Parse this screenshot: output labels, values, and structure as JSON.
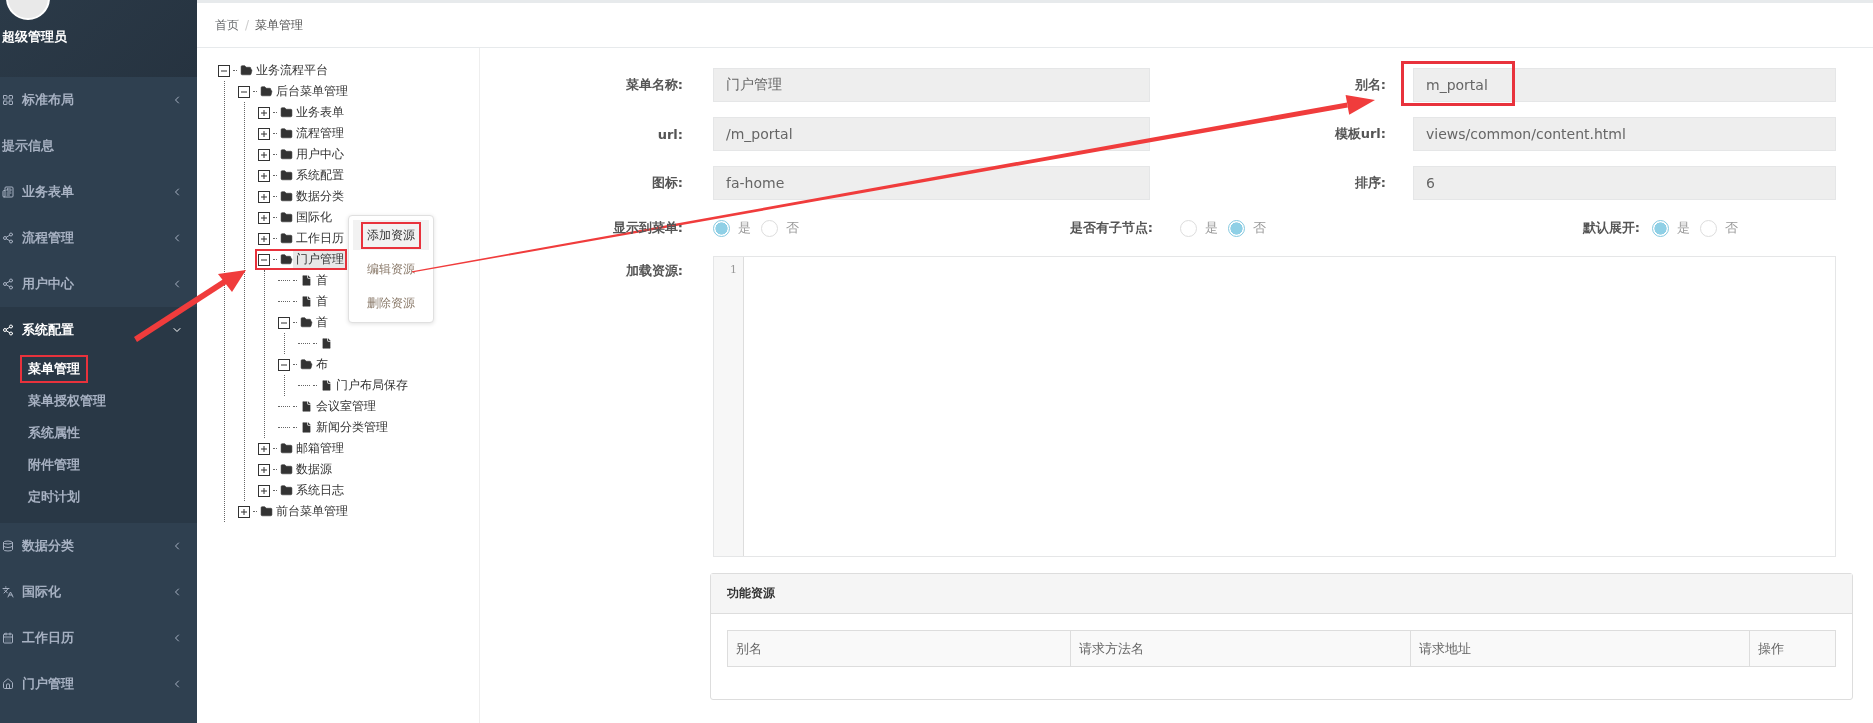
{
  "user": {
    "name": "超级管理员"
  },
  "sidebar": {
    "items": [
      {
        "label": "标准布局",
        "expanded": false
      },
      {
        "label": "提示信息"
      },
      {
        "label": "业务表单",
        "expanded": false
      },
      {
        "label": "流程管理",
        "expanded": false
      },
      {
        "label": "用户中心",
        "expanded": false
      },
      {
        "label": "系统配置",
        "expanded": true,
        "children": [
          {
            "label": "菜单管理",
            "selected": true,
            "highlighted": true
          },
          {
            "label": "菜单授权管理",
            "selected": false,
            "highlighted": false
          },
          {
            "label": "系统属性",
            "selected": false,
            "highlighted": false
          },
          {
            "label": "附件管理",
            "selected": false,
            "highlighted": false
          },
          {
            "label": "定时计划",
            "selected": false,
            "highlighted": false
          }
        ]
      },
      {
        "label": "数据分类",
        "expanded": false
      },
      {
        "label": "国际化",
        "expanded": false
      },
      {
        "label": "工作日历",
        "expanded": false
      },
      {
        "label": "门户管理",
        "expanded": false
      }
    ]
  },
  "breadcrumb": [
    "首页",
    "菜单管理"
  ],
  "breadcrumb_separator": "/",
  "tree": [
    {
      "label": "业务流程平台",
      "kind": "folder",
      "expanded": true,
      "children": [
        {
          "label": "后台菜单管理",
          "kind": "folder",
          "expanded": true,
          "children": [
            {
              "label": "业务表单",
              "kind": "folder",
              "expanded": false
            },
            {
              "label": "流程管理",
              "kind": "folder",
              "expanded": false
            },
            {
              "label": "用户中心",
              "kind": "folder",
              "expanded": false
            },
            {
              "label": "系统配置",
              "kind": "folder",
              "expanded": false
            },
            {
              "label": "数据分类",
              "kind": "folder",
              "expanded": false
            },
            {
              "label": "国际化",
              "kind": "folder",
              "expanded": false
            },
            {
              "label": "工作日历",
              "kind": "folder",
              "expanded": false
            },
            {
              "label": "门户管理",
              "kind": "folder",
              "expanded": true,
              "highlighted": true,
              "selected": true,
              "children": [
                {
                  "label": "首",
                  "kind": "file"
                },
                {
                  "label": "首",
                  "kind": "file"
                },
                {
                  "label": "首",
                  "kind": "folder",
                  "expanded": true,
                  "children": [
                    {
                      "kind": "file"
                    }
                  ]
                },
                {
                  "label": "布",
                  "kind": "folder",
                  "expanded": true,
                  "children": [
                    {
                      "label": "门户布局保存",
                      "kind": "file"
                    }
                  ]
                },
                {
                  "label": "会议室管理",
                  "kind": "file"
                },
                {
                  "label": "新闻分类管理",
                  "kind": "file"
                }
              ]
            },
            {
              "label": "邮箱管理",
              "kind": "folder",
              "expanded": false
            },
            {
              "label": "数据源",
              "kind": "folder",
              "expanded": false
            },
            {
              "label": "系统日志",
              "kind": "folder",
              "expanded": false
            }
          ]
        },
        {
          "label": "前台菜单管理",
          "kind": "folder",
          "expanded": false
        }
      ]
    }
  ],
  "context_menu": [
    {
      "label": "添加资源",
      "selected": true,
      "highlighted": true
    },
    {
      "label": "编辑资源",
      "selected": false,
      "highlighted": false
    },
    {
      "label": "删除资源",
      "selected": false,
      "highlighted": false
    }
  ],
  "form": {
    "fields": [
      {
        "label": "菜单名称:",
        "value": "门户管理"
      },
      {
        "label": "别名:",
        "value": "m_portal",
        "highlighted": true
      },
      {
        "label": "url:",
        "value": "/m_portal"
      },
      {
        "label": "模板url:",
        "value": "views/common/content.html"
      },
      {
        "label": "图标:",
        "value": "fa-home"
      },
      {
        "label": "排序:",
        "value": "6"
      }
    ],
    "radio_groups": [
      {
        "label": "显示到菜单:",
        "options": [
          {
            "label": "是",
            "selected": true
          },
          {
            "label": "否",
            "selected": false
          }
        ]
      },
      {
        "label": "是否有子节点:",
        "options": [
          {
            "label": "是",
            "selected": false
          },
          {
            "label": "否",
            "selected": true
          }
        ]
      },
      {
        "label": "默认展开:",
        "options": [
          {
            "label": "是",
            "selected": true
          },
          {
            "label": "否",
            "selected": false
          }
        ]
      }
    ],
    "editor": {
      "label": "加载资源:",
      "line_numbers": [
        "1"
      ]
    }
  },
  "resources_panel": {
    "title": "功能资源",
    "columns": [
      "别名",
      "请求方法名",
      "请求地址",
      "操作"
    ]
  }
}
